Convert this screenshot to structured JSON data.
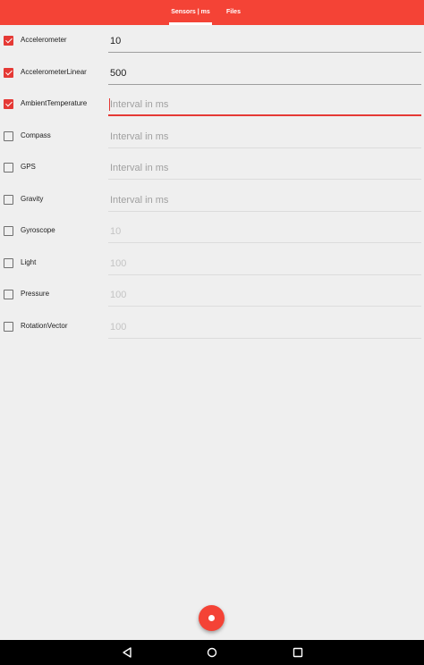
{
  "tabs": [
    {
      "label": "Sensors | ms",
      "active": true
    },
    {
      "label": "Files",
      "active": false
    }
  ],
  "sensors": [
    {
      "name": "Accelerometer",
      "checked": true,
      "value": "10",
      "placeholder": ""
    },
    {
      "name": "AccelerometerLinear",
      "checked": true,
      "value": "500",
      "placeholder": ""
    },
    {
      "name": "AmbientTemperature",
      "checked": true,
      "value": "",
      "placeholder": "Interval in ms",
      "focused": true
    },
    {
      "name": "Compass",
      "checked": false,
      "value": "",
      "placeholder": "Interval in ms"
    },
    {
      "name": "GPS",
      "checked": false,
      "value": "",
      "placeholder": "Interval in ms"
    },
    {
      "name": "Gravity",
      "checked": false,
      "value": "",
      "placeholder": "Interval in ms"
    },
    {
      "name": "Gyroscope",
      "checked": false,
      "value": "10",
      "placeholder": "",
      "disabled": true
    },
    {
      "name": "Light",
      "checked": false,
      "value": "100",
      "placeholder": "",
      "disabled": true
    },
    {
      "name": "Pressure",
      "checked": false,
      "value": "100",
      "placeholder": "",
      "disabled": true
    },
    {
      "name": "RotationVector",
      "checked": false,
      "value": "100",
      "placeholder": "",
      "disabled": true
    }
  ],
  "fab": {
    "icon": "record-icon"
  },
  "navbar": {
    "back_icon": "back-icon",
    "home_icon": "home-icon",
    "recent_icon": "recent-apps-icon"
  },
  "colors": {
    "accent": "#f44336",
    "checkbox_on": "#e53935"
  }
}
